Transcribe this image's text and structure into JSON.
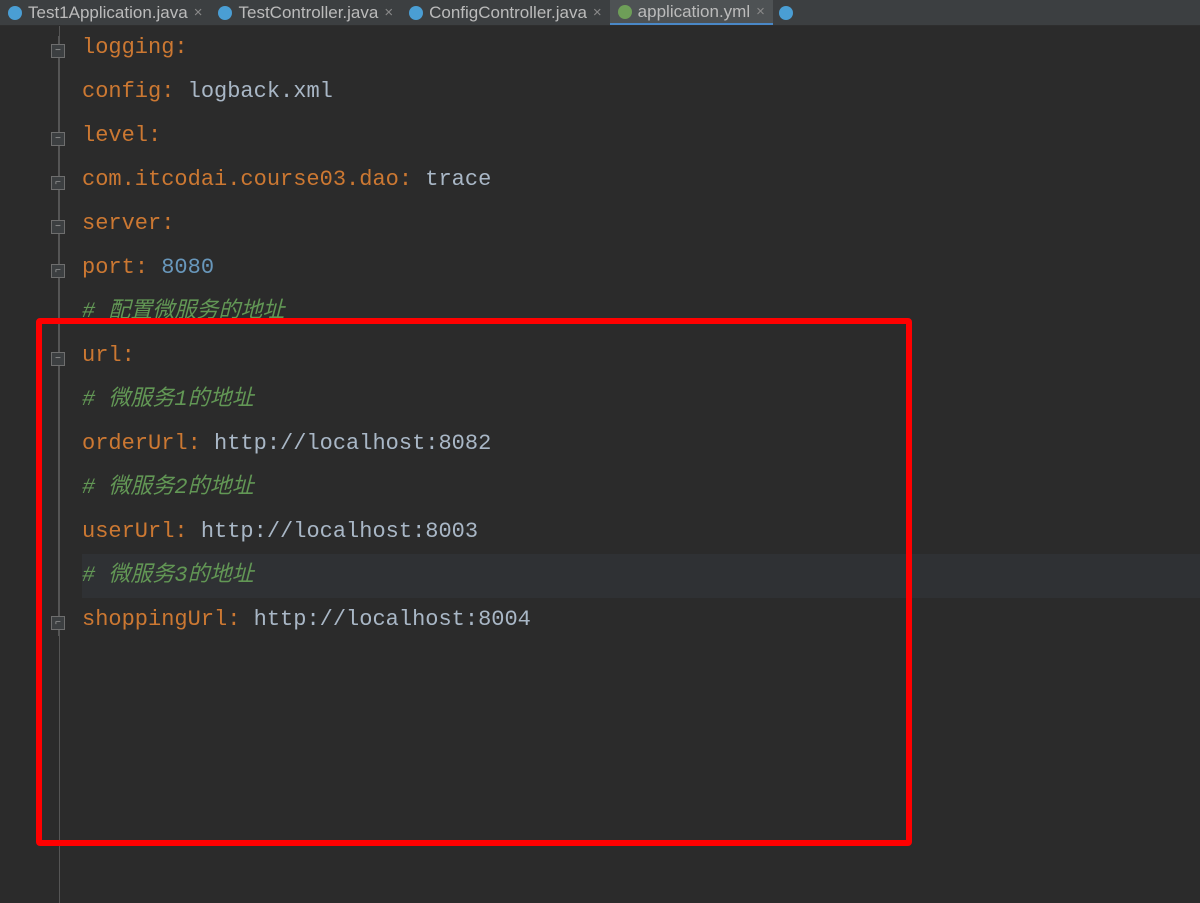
{
  "tabs": [
    {
      "label": "Test1Application.java",
      "active": false
    },
    {
      "label": "TestController.java",
      "active": false
    },
    {
      "label": "ConfigController.java",
      "active": false
    },
    {
      "label": "application.yml",
      "active": true
    }
  ],
  "code": {
    "l1_key": "logging",
    "l2_key": "config",
    "l2_val": "logback.xml",
    "l3_key": "level",
    "l4_key": "com.itcodai.course03.dao",
    "l4_val": "trace",
    "l5_key": "server",
    "l6_key": "port",
    "l6_val": "8080",
    "c1": "# 配置微服务的地址",
    "l7_key": "url",
    "c2": "# 微服务1的地址",
    "l8_key": "orderUrl",
    "l8_val": "http://localhost:8082",
    "c3": "# 微服务2的地址",
    "l9_key": "userUrl",
    "l9_val": "http://localhost:8003",
    "c4": "# 微服务3的地址",
    "l10_key": "shoppingUrl",
    "l10_val": "http://localhost:8004"
  },
  "colors": {
    "bg": "#2b2b2b",
    "key": "#cc7832",
    "comment": "#629755",
    "num": "#6897bb",
    "text": "#a9b7c6"
  }
}
